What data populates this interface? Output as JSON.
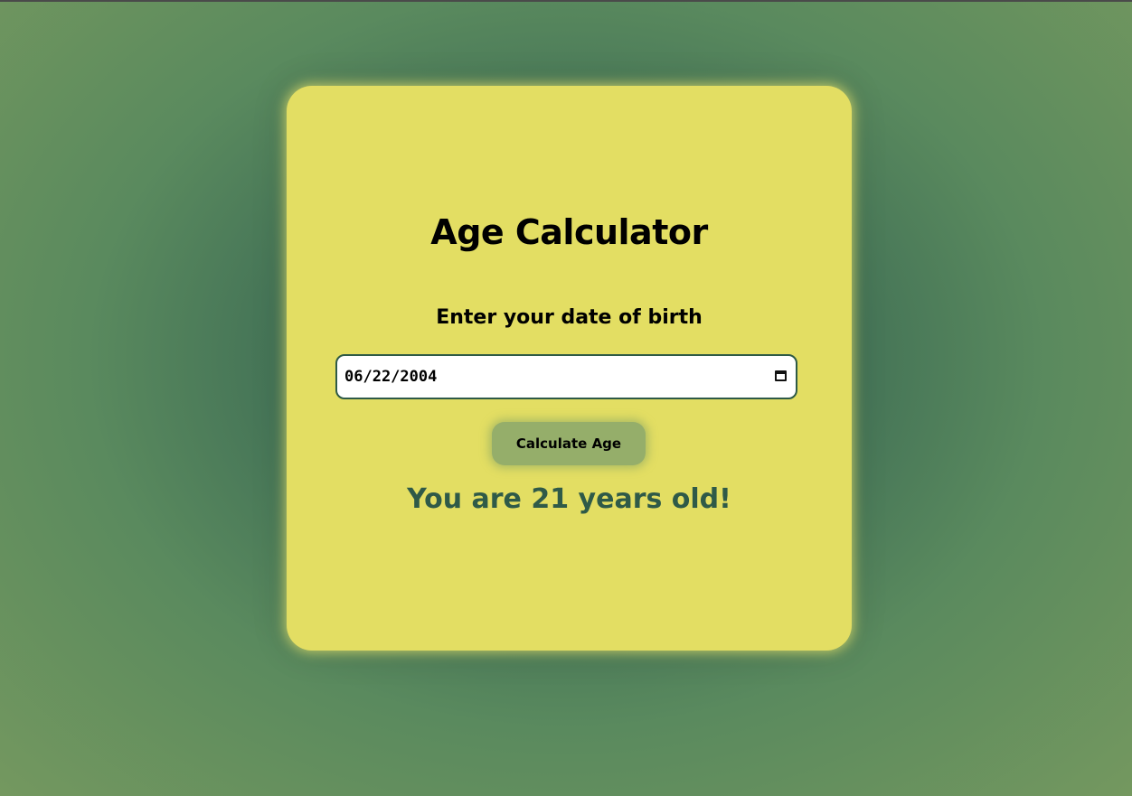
{
  "app": {
    "title": "Age Calculator"
  },
  "form": {
    "prompt_label": "Enter your date of birth",
    "date_value": "06/22/2004",
    "submit_label": "Calculate Age"
  },
  "result": {
    "text": "You are 21 years old!"
  },
  "icons": {
    "date_picker": "calendar-icon"
  },
  "colors": {
    "card_background": "#e3de63",
    "button_background": "#95ae6a",
    "result_text": "#2f5a48",
    "input_border": "#2e5a46"
  }
}
